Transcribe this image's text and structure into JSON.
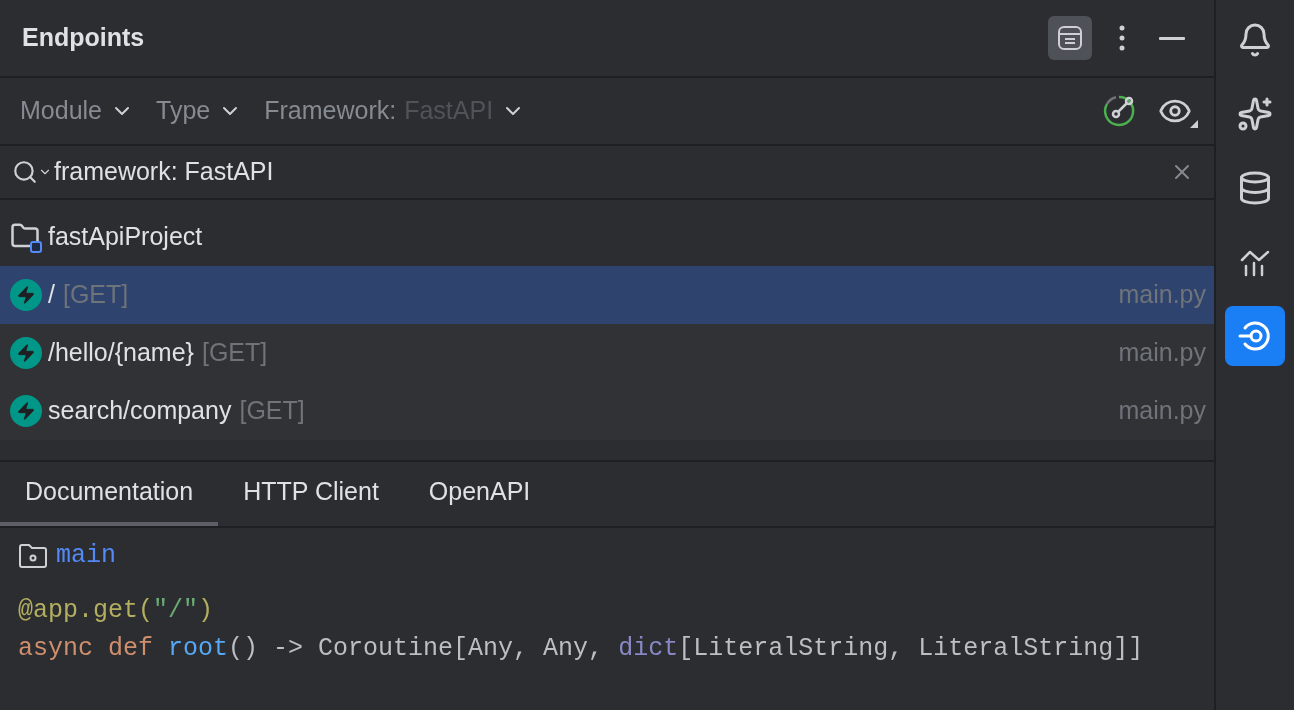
{
  "panel": {
    "title": "Endpoints"
  },
  "filters": [
    {
      "label": "Module"
    },
    {
      "label": "Type"
    },
    {
      "label": "Framework:",
      "value": "FastAPI"
    }
  ],
  "search": {
    "value": "framework: FastAPI"
  },
  "tree": {
    "label": "fastApiProject",
    "children": [
      {
        "path": "/",
        "method": "[GET]",
        "file": "main.py",
        "selected": true
      },
      {
        "path": "/hello/{name}",
        "method": "[GET]",
        "file": "main.py",
        "selected": false
      },
      {
        "path": "search/company",
        "method": "[GET]",
        "file": "main.py",
        "selected": false
      }
    ]
  },
  "tabs": [
    {
      "label": "Documentation",
      "selected": true
    },
    {
      "label": "HTTP Client",
      "selected": false
    },
    {
      "label": "OpenAPI",
      "selected": false
    }
  ],
  "documentation": {
    "module": "main",
    "code_lines": [
      [
        {
          "kind": "decorator",
          "text": "@app.get("
        },
        {
          "kind": "string",
          "text": "\"/\""
        },
        {
          "kind": "decorator",
          "text": ")"
        }
      ],
      [
        {
          "kind": "keyword",
          "text": "async def "
        },
        {
          "kind": "function",
          "text": "root"
        },
        {
          "kind": "plain",
          "text": "() -> Coroutine[Any, Any, "
        },
        {
          "kind": "builtin",
          "text": "dict"
        },
        {
          "kind": "plain",
          "text": "[LiteralString, LiteralString]]"
        }
      ]
    ]
  },
  "side_toolbar": [
    {
      "kind": "bell",
      "selected": false
    },
    {
      "kind": "sparkles",
      "selected": false
    },
    {
      "kind": "database",
      "selected": false
    },
    {
      "kind": "chart",
      "selected": false
    },
    {
      "kind": "endpoints",
      "selected": true
    }
  ]
}
